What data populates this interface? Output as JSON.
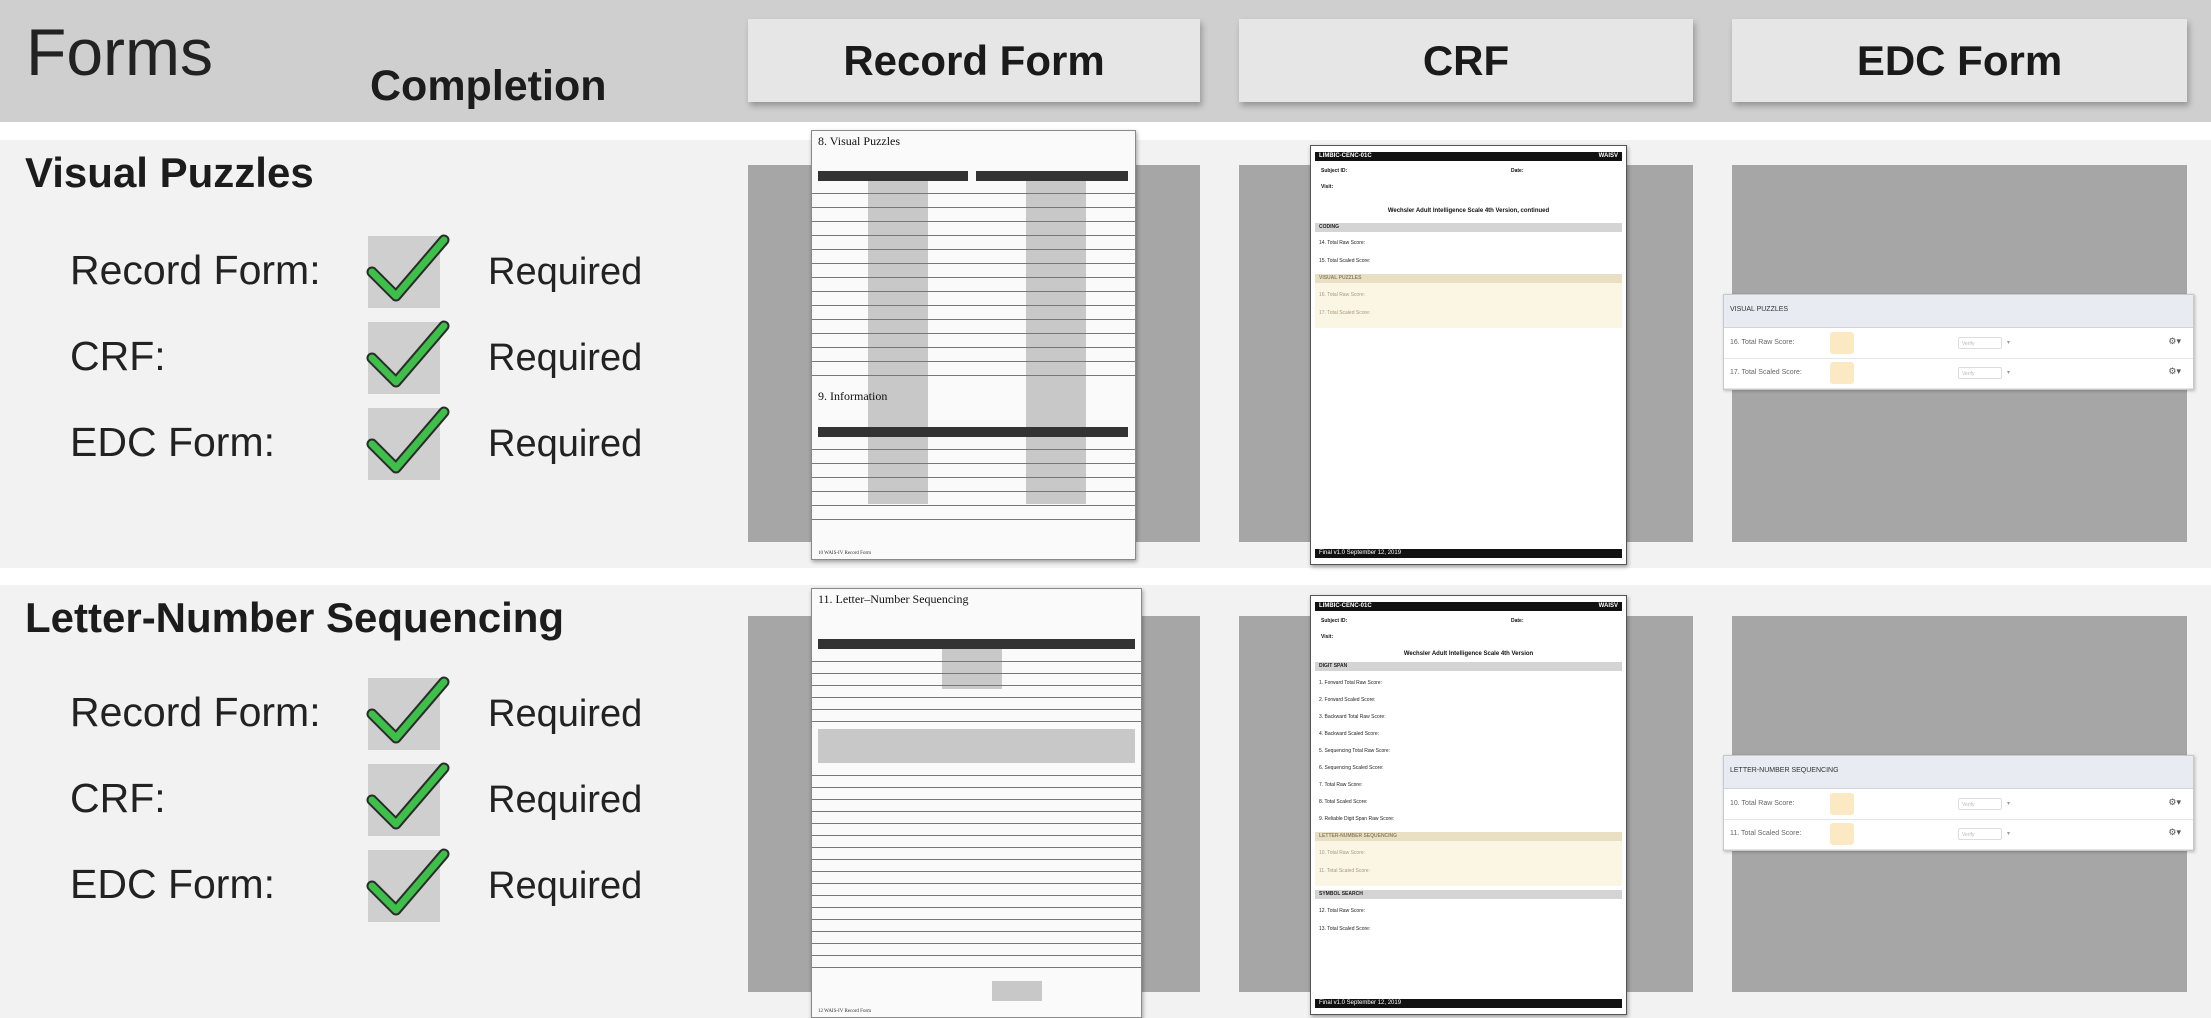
{
  "header": {
    "title": "Forms",
    "completion_label": "Completion",
    "columns": [
      "Record Form",
      "CRF",
      "EDC Form"
    ]
  },
  "sections": [
    {
      "title": "Visual Puzzles",
      "requirements": [
        {
          "label": "Record Form:",
          "status": "Required"
        },
        {
          "label": "CRF:",
          "status": "Required"
        },
        {
          "label": "EDC Form:",
          "status": "Required"
        }
      ],
      "record_form": {
        "title": "8. Visual Puzzles",
        "second_title": "9. Information",
        "footer": "10  WAIS-IV  Record Form"
      },
      "crf": {
        "header_left": "LIMBIC-CENC-01C",
        "header_right": "WAISV",
        "subject_label": "Subject ID:",
        "date_label": "Date:",
        "visit_label": "Visit:",
        "scale_title": "Wechsler Adult Intelligence Scale 4th Version, continued",
        "section1": "CODING",
        "field1": "14. Total Raw Score:",
        "field2": "15. Total Scaled Score:",
        "section2": "VISUAL PUZZLES",
        "field3": "16. Total Raw Score:",
        "field4": "17. Total Scaled Score:",
        "footer": "Final v1.0 September 12, 2019"
      },
      "edc": {
        "header": "VISUAL PUZZLES",
        "rows": [
          {
            "label": "16. Total Raw Score:",
            "verify": "Verify"
          },
          {
            "label": "17. Total Scaled Score:",
            "verify": "Verify"
          }
        ]
      }
    },
    {
      "title": "Letter-Number Sequencing",
      "requirements": [
        {
          "label": "Record Form:",
          "status": "Required"
        },
        {
          "label": "CRF:",
          "status": "Required"
        },
        {
          "label": "EDC Form:",
          "status": "Required"
        }
      ],
      "record_form": {
        "title": "11. Letter–Number Sequencing",
        "footer": "12  WAIS-IV  Record Form"
      },
      "crf": {
        "header_left": "LIMBIC-CENC-01C",
        "header_right": "WAISV",
        "subject_label": "Subject ID:",
        "date_label": "Date:",
        "visit_label": "Visit:",
        "scale_title": "Wechsler Adult Intelligence Scale 4th Version",
        "section1": "DIGIT SPAN",
        "fields_a": [
          "1. Forward Total Raw Score:",
          "2. Forward Scaled Score:",
          "3. Backward Total Raw Score:",
          "4. Backward Scaled Score:",
          "5. Sequencing Total Raw Score:",
          "6. Sequencing Scaled Score:",
          "7. Total Raw Score:",
          "8. Total Scaled Score:",
          "9. Reliable Digit Span Raw Score:"
        ],
        "section2": "LETTER-NUMBER SEQUENCING",
        "fields_b": [
          "10. Total Raw Score:",
          "11. Total Scaled Score:"
        ],
        "section3": "SYMBOL SEARCH",
        "fields_c": [
          "12. Total Raw Score:",
          "13. Total Scaled Score:"
        ],
        "footer": "Final v1.0 September 12, 2019"
      },
      "edc": {
        "header": "LETTER-NUMBER SEQUENCING",
        "rows": [
          {
            "label": "10. Total Raw Score:",
            "verify": "Verify"
          },
          {
            "label": "11. Total Scaled Score:",
            "verify": "Verify"
          }
        ]
      }
    }
  ],
  "colors": {
    "header_bg": "#cfcfcf",
    "section_bg": "#f2f2f2",
    "panel_gray": "#a6a6a6",
    "check_green": "#3dbf4a",
    "edc_input": "#fbe9c4"
  },
  "icons": {
    "check": "check-icon",
    "gear": "gear-icon"
  }
}
